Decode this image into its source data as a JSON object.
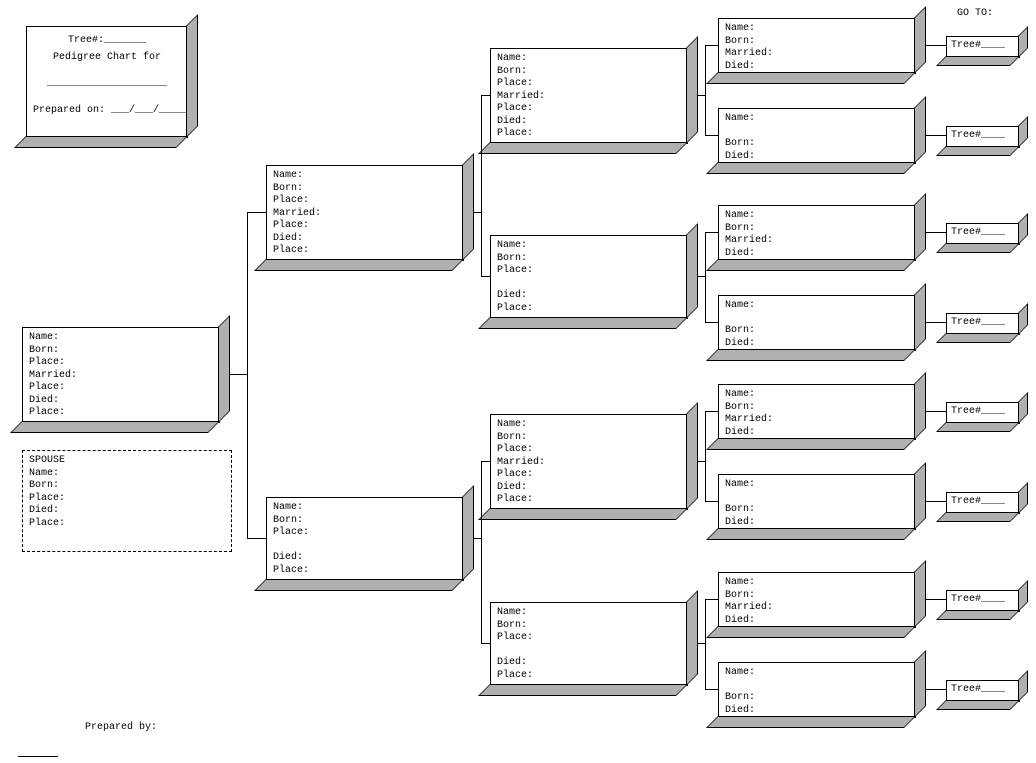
{
  "goto_label": "GO TO:",
  "header": {
    "tree_line": "Tree#:_______",
    "title": "Pedigree Chart for",
    "blank": "____________________",
    "prepared": "Prepared on: ___/___/_____"
  },
  "full_fields": {
    "name": "Name:",
    "born": "Born:",
    "place1": "Place:",
    "married": "Married:",
    "place2": "Place:",
    "died": "Died:",
    "place3": "Place:"
  },
  "female_fields": {
    "name": "Name:",
    "born": "Born:",
    "place1": "Place:",
    "blank": " ",
    "died": "Died:",
    "place2": "Place:"
  },
  "gp_male": {
    "name": "Name:",
    "born": "Born:",
    "married": "Married:",
    "died": "Died:"
  },
  "gp_female": {
    "name": "Name:",
    "blank": " ",
    "born": "Born:",
    "died": "Died:"
  },
  "spouse": {
    "title": "SPOUSE",
    "name": "Name:",
    "blank": " ",
    "born": "Born:",
    "place": "Place:",
    "died": "Died:",
    "place2": "Place:"
  },
  "treeref": "Tree#____",
  "prepared_by": "Prepared by:"
}
